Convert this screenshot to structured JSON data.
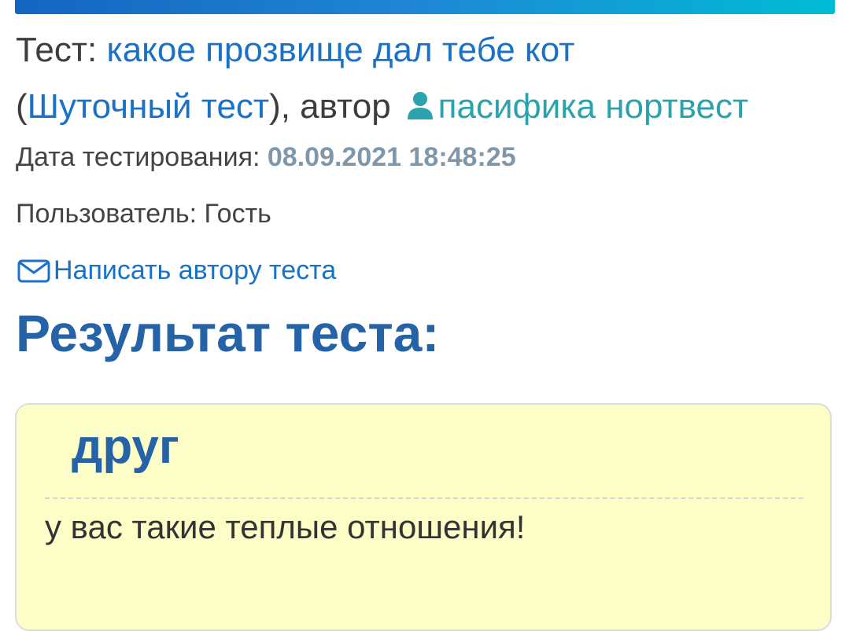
{
  "header": {
    "prefix": "Тест: ",
    "test_title": "какое прозвище дал тебе кот",
    "open_paren": "(",
    "category": "Шуточный тест",
    "close_author": "), автор",
    "author": "пасифика нортвест"
  },
  "meta": {
    "date_label": "Дата тестирования: ",
    "date_value": "08.09.2021 18:48:25",
    "user_label": "Пользователь: ",
    "user_value": "Гость"
  },
  "contact": {
    "label": "Написать автору теста",
    "icon": "envelope-icon"
  },
  "result": {
    "heading": "Результат теста:",
    "title": "друг",
    "text": "у вас такие теплые отношения!"
  },
  "colors": {
    "link": "#1a72c7",
    "author": "#2aa3ad",
    "heading": "#2563a6",
    "date": "#7f97a8",
    "result_bg": "#fdfdc8"
  }
}
